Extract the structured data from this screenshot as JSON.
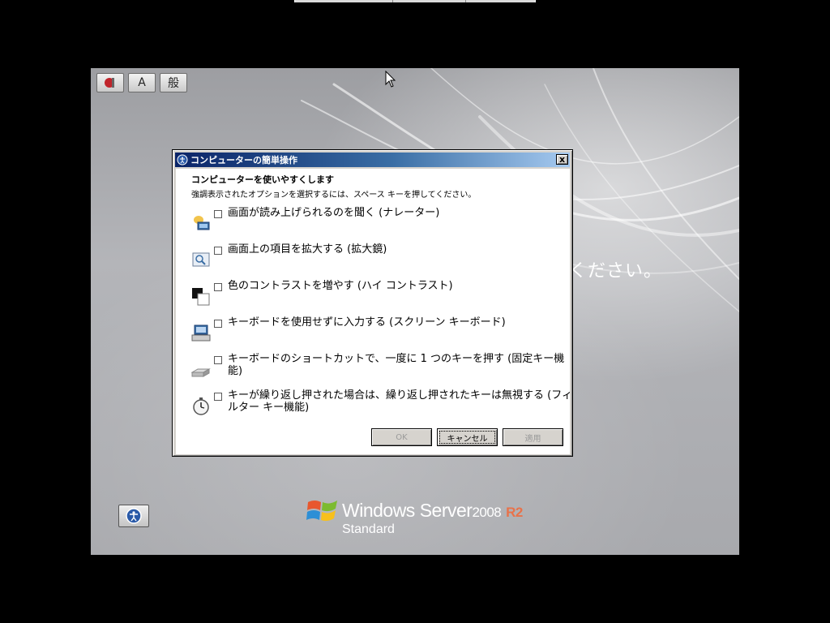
{
  "background": {
    "partial_message": "ください。",
    "brand_name": "Windows Server",
    "brand_version": "2008",
    "brand_release": "R2",
    "brand_edition": "Standard",
    "accent_color": "#e8724a"
  },
  "toolbar": {
    "ime_button_label": "A",
    "kana_button_label": "般"
  },
  "dialog": {
    "title": "コンピューターの簡単操作",
    "close_label": "x",
    "heading": "コンピューターを使いやすくします",
    "instruction": "強調表示されたオプションを選択するには、スペース キーを押してください。",
    "options": [
      {
        "icon": "narrator-icon",
        "label": "画面が読み上げられるのを聞く (ナレーター)",
        "checked": false
      },
      {
        "icon": "magnifier-icon",
        "label": "画面上の項目を拡大する (拡大鏡)",
        "checked": false
      },
      {
        "icon": "high-contrast-icon",
        "label": "色のコントラストを増やす (ハイ コントラスト)",
        "checked": false
      },
      {
        "icon": "onscreen-keyboard-icon",
        "label": "キーボードを使用せずに入力する (スクリーン キーボード)",
        "checked": false
      },
      {
        "icon": "sticky-keys-icon",
        "label": "キーボードのショートカットで、一度に 1 つのキーを押す (固定キー機能)",
        "checked": false
      },
      {
        "icon": "filter-keys-icon",
        "label": "キーが繰り返し押された場合は、繰り返し押されたキーは無視する (フィルター キー機能)",
        "checked": false
      }
    ],
    "buttons": {
      "ok": "OK",
      "cancel": "キャンセル",
      "apply": "適用"
    }
  }
}
